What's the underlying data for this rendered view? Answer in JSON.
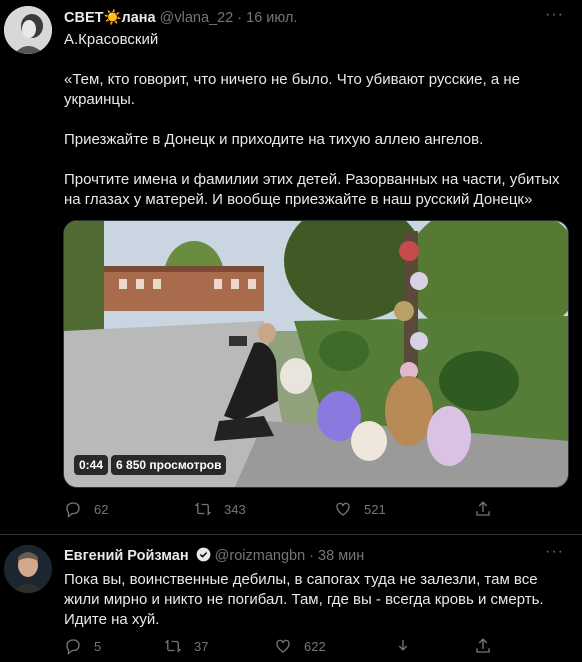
{
  "tweet1": {
    "display_name": "СВЕТ☀️лана",
    "handle": "@vlana_22",
    "separator": "·",
    "date": "16 июл.",
    "text": "А.Красовский\n\n«Тем, кто говорит, что ничего не было. Что убивают русские, а не украинцы.\n\nПриезжайте в Донецк и приходите на тихую аллею ангелов.\n\nПрочтите имена и фамилии этих детей. Разорванных на части, убитых на глазах у матерей. И вообще приезжайте в наш русский Донецк»",
    "video": {
      "duration": "0:44",
      "views": "6 850 просмотров"
    },
    "actions": {
      "replies": "62",
      "retweets": "343",
      "likes": "521"
    },
    "more_label": "···"
  },
  "tweet2": {
    "display_name": "Евгений Ройзман",
    "handle": "@roizmangbn",
    "separator": "·",
    "date": "38 мин",
    "text": "Пока вы, воинственные дебилы, в сапогах туда не залезли, там все жили мирно и никто не погибал. Там, где вы - всегда кровь и смерть. Идите на хуй.",
    "actions": {
      "replies": "5",
      "retweets": "37",
      "likes": "622"
    },
    "more_label": "···"
  },
  "colors": {
    "background": "#000000",
    "text": "#e7e9ea",
    "muted": "#71767b",
    "verified": "#1d9bf0",
    "divider": "#2f3336"
  },
  "icons": [
    "reply-icon",
    "retweet-icon",
    "like-icon",
    "share-icon",
    "verified-badge-icon",
    "more-icon"
  ]
}
